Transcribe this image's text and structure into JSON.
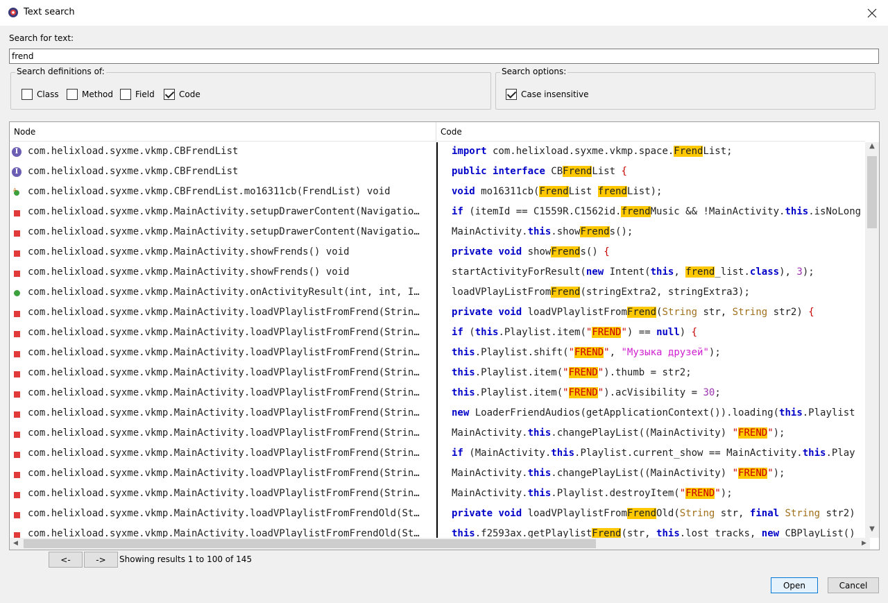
{
  "window": {
    "title": "Text search"
  },
  "search": {
    "label": "Search for text:",
    "value": "frend"
  },
  "definitions": {
    "title": "Search definitions of:",
    "items": [
      {
        "label": "Class",
        "checked": false
      },
      {
        "label": "Method",
        "checked": false
      },
      {
        "label": "Field",
        "checked": false
      },
      {
        "label": "Code",
        "checked": true
      }
    ]
  },
  "options": {
    "title": "Search options:",
    "items": [
      {
        "label": "Case insensitive",
        "checked": true
      }
    ]
  },
  "table": {
    "columns": [
      "Node",
      "Code"
    ],
    "rows": [
      {
        "icon": "interface-icon",
        "node": "com.helixload.syxme.vkmp.CBFrendList",
        "code": [
          [
            "kw",
            "import"
          ],
          [
            "t",
            " com.helixload.syxme.vkmp.space."
          ],
          [
            "hl",
            "Frend"
          ],
          [
            "t",
            "List;"
          ]
        ]
      },
      {
        "icon": "interface-icon",
        "node": "com.helixload.syxme.vkmp.CBFrendList",
        "code": [
          [
            "kw",
            "public"
          ],
          [
            "t",
            " "
          ],
          [
            "kw",
            "interface"
          ],
          [
            "t",
            " CB"
          ],
          [
            "hl",
            "Frend"
          ],
          [
            "t",
            "List "
          ],
          [
            "str",
            "{"
          ]
        ]
      },
      {
        "icon": "abstract-method-icon",
        "node": "com.helixload.syxme.vkmp.CBFrendList.mo16311cb(FrendList) void",
        "code": [
          [
            "kw",
            "void"
          ],
          [
            "t",
            " mo16311cb("
          ],
          [
            "hl",
            "Frend"
          ],
          [
            "t",
            "List "
          ],
          [
            "hl",
            "frend"
          ],
          [
            "t",
            "List);"
          ]
        ]
      },
      {
        "icon": "private-method-icon",
        "node": "com.helixload.syxme.vkmp.MainActivity.setupDrawerContent(Navigatio…",
        "code": [
          [
            "kw",
            "if"
          ],
          [
            "t",
            " (itemId == C1559R.C1562id."
          ],
          [
            "hl",
            "frend"
          ],
          [
            "t",
            "Music && !MainActivity."
          ],
          [
            "kw",
            "this"
          ],
          [
            "t",
            ".isNoLong"
          ]
        ]
      },
      {
        "icon": "private-method-icon",
        "node": "com.helixload.syxme.vkmp.MainActivity.setupDrawerContent(Navigatio…",
        "code": [
          [
            "t",
            "MainActivity."
          ],
          [
            "kw",
            "this"
          ],
          [
            "t",
            ".show"
          ],
          [
            "hl",
            "Frend"
          ],
          [
            "t",
            "s();"
          ]
        ]
      },
      {
        "icon": "private-method-icon",
        "node": "com.helixload.syxme.vkmp.MainActivity.showFrends() void",
        "code": [
          [
            "kw",
            "private"
          ],
          [
            "t",
            " "
          ],
          [
            "kw",
            "void"
          ],
          [
            "t",
            " show"
          ],
          [
            "hl",
            "Frend"
          ],
          [
            "t",
            "s() "
          ],
          [
            "str",
            "{"
          ]
        ]
      },
      {
        "icon": "private-method-icon",
        "node": "com.helixload.syxme.vkmp.MainActivity.showFrends() void",
        "code": [
          [
            "t",
            "startActivityForResult("
          ],
          [
            "kw",
            "new"
          ],
          [
            "t",
            " Intent("
          ],
          [
            "kw",
            "this"
          ],
          [
            "t",
            ", "
          ],
          [
            "hl",
            "frend"
          ],
          [
            "t",
            "_list."
          ],
          [
            "kw",
            "class"
          ],
          [
            "t",
            "), "
          ],
          [
            "num",
            "3"
          ],
          [
            "t",
            ");"
          ]
        ]
      },
      {
        "icon": "public-method-icon",
        "node": "com.helixload.syxme.vkmp.MainActivity.onActivityResult(int, int, I…",
        "code": [
          [
            "t",
            "loadVPlayListFrom"
          ],
          [
            "hl",
            "Frend"
          ],
          [
            "t",
            "(stringExtra2, stringExtra3);"
          ]
        ]
      },
      {
        "icon": "private-method-icon",
        "node": "com.helixload.syxme.vkmp.MainActivity.loadVPlaylistFromFrend(Strin…",
        "code": [
          [
            "kw",
            "private"
          ],
          [
            "t",
            " "
          ],
          [
            "kw",
            "void"
          ],
          [
            "t",
            " loadVPlaylistFrom"
          ],
          [
            "hl",
            "Frend"
          ],
          [
            "t",
            "("
          ],
          [
            "ty",
            "String"
          ],
          [
            "t",
            " str, "
          ],
          [
            "ty",
            "String"
          ],
          [
            "t",
            " str2) "
          ],
          [
            "str",
            "{"
          ]
        ]
      },
      {
        "icon": "private-method-icon",
        "node": "com.helixload.syxme.vkmp.MainActivity.loadVPlaylistFromFrend(Strin…",
        "code": [
          [
            "kw",
            "if"
          ],
          [
            "t",
            " ("
          ],
          [
            "kw",
            "this"
          ],
          [
            "t",
            ".Playlist.item("
          ],
          [
            "str",
            "\""
          ],
          [
            "hlstr",
            "FREND"
          ],
          [
            "str",
            "\""
          ],
          [
            "t",
            ") == "
          ],
          [
            "kw",
            "null"
          ],
          [
            "t",
            ") "
          ],
          [
            "str",
            "{"
          ]
        ]
      },
      {
        "icon": "private-method-icon",
        "node": "com.helixload.syxme.vkmp.MainActivity.loadVPlaylistFromFrend(Strin…",
        "code": [
          [
            "kw",
            "this"
          ],
          [
            "t",
            ".Playlist.shift("
          ],
          [
            "str",
            "\""
          ],
          [
            "hlstr",
            "FREND"
          ],
          [
            "str",
            "\""
          ],
          [
            "t",
            ", "
          ],
          [
            "ru",
            "\"Музыка друзей\""
          ],
          [
            "t",
            ");"
          ]
        ]
      },
      {
        "icon": "private-method-icon",
        "node": "com.helixload.syxme.vkmp.MainActivity.loadVPlaylistFromFrend(Strin…",
        "code": [
          [
            "kw",
            "this"
          ],
          [
            "t",
            ".Playlist.item("
          ],
          [
            "str",
            "\""
          ],
          [
            "hlstr",
            "FREND"
          ],
          [
            "str",
            "\""
          ],
          [
            "t",
            ").thumb = str2;"
          ]
        ]
      },
      {
        "icon": "private-method-icon",
        "node": "com.helixload.syxme.vkmp.MainActivity.loadVPlaylistFromFrend(Strin…",
        "code": [
          [
            "kw",
            "this"
          ],
          [
            "t",
            ".Playlist.item("
          ],
          [
            "str",
            "\""
          ],
          [
            "hlstr",
            "FREND"
          ],
          [
            "str",
            "\""
          ],
          [
            "t",
            ").acVisibility = "
          ],
          [
            "num",
            "30"
          ],
          [
            "t",
            ";"
          ]
        ]
      },
      {
        "icon": "private-method-icon",
        "node": "com.helixload.syxme.vkmp.MainActivity.loadVPlaylistFromFrend(Strin…",
        "code": [
          [
            "kw",
            "new"
          ],
          [
            "t",
            " LoaderFriendAudios(getApplicationContext()).loading("
          ],
          [
            "kw",
            "this"
          ],
          [
            "t",
            ".Playlist"
          ]
        ]
      },
      {
        "icon": "private-method-icon",
        "node": "com.helixload.syxme.vkmp.MainActivity.loadVPlaylistFromFrend(Strin…",
        "code": [
          [
            "t",
            "MainActivity."
          ],
          [
            "kw",
            "this"
          ],
          [
            "t",
            ".changePlayList((MainActivity) "
          ],
          [
            "str",
            "\""
          ],
          [
            "hlstr",
            "FREND"
          ],
          [
            "str",
            "\""
          ],
          [
            "t",
            ");"
          ]
        ]
      },
      {
        "icon": "private-method-icon",
        "node": "com.helixload.syxme.vkmp.MainActivity.loadVPlaylistFromFrend(Strin…",
        "code": [
          [
            "kw",
            "if"
          ],
          [
            "t",
            " (MainActivity."
          ],
          [
            "kw",
            "this"
          ],
          [
            "t",
            ".Playlist.current_show == MainActivity."
          ],
          [
            "kw",
            "this"
          ],
          [
            "t",
            ".Play"
          ]
        ]
      },
      {
        "icon": "private-method-icon",
        "node": "com.helixload.syxme.vkmp.MainActivity.loadVPlaylistFromFrend(Strin…",
        "code": [
          [
            "t",
            "MainActivity."
          ],
          [
            "kw",
            "this"
          ],
          [
            "t",
            ".changePlayList((MainActivity) "
          ],
          [
            "str",
            "\""
          ],
          [
            "hlstr",
            "FREND"
          ],
          [
            "str",
            "\""
          ],
          [
            "t",
            ");"
          ]
        ]
      },
      {
        "icon": "private-method-icon",
        "node": "com.helixload.syxme.vkmp.MainActivity.loadVPlaylistFromFrend(Strin…",
        "code": [
          [
            "t",
            "MainActivity."
          ],
          [
            "kw",
            "this"
          ],
          [
            "t",
            ".Playlist.destroyItem("
          ],
          [
            "str",
            "\""
          ],
          [
            "hlstr",
            "FREND"
          ],
          [
            "str",
            "\""
          ],
          [
            "t",
            ");"
          ]
        ]
      },
      {
        "icon": "private-method-icon",
        "node": "com.helixload.syxme.vkmp.MainActivity.loadVPlaylistFromFrendOld(St…",
        "code": [
          [
            "kw",
            "private"
          ],
          [
            "t",
            " "
          ],
          [
            "kw",
            "void"
          ],
          [
            "t",
            " loadVPlaylistFrom"
          ],
          [
            "hl",
            "Frend"
          ],
          [
            "t",
            "Old("
          ],
          [
            "ty",
            "String"
          ],
          [
            "t",
            " str, "
          ],
          [
            "kw",
            "final"
          ],
          [
            "t",
            " "
          ],
          [
            "ty",
            "String"
          ],
          [
            "t",
            " str2)"
          ]
        ]
      },
      {
        "icon": "private-method-icon",
        "node": "com.helixload.syxme.vkmp.MainActivity.loadVPlaylistFromFrendOld(St…",
        "code": [
          [
            "kw",
            "this"
          ],
          [
            "t",
            ".f2593ax.getPlaylist"
          ],
          [
            "hl",
            "Frend"
          ],
          [
            "t",
            "(str, "
          ],
          [
            "kw",
            "this"
          ],
          [
            "t",
            ".lost_tracks, "
          ],
          [
            "kw",
            "new"
          ],
          [
            "t",
            " CBPlayList()"
          ]
        ]
      }
    ]
  },
  "pager": {
    "prev_label": "<-",
    "next_label": "->",
    "status": "Showing results 1 to 100 of 145"
  },
  "buttons": {
    "open_label": "Open",
    "cancel_label": "Cancel"
  },
  "colors": {
    "highlight": "#ffc800",
    "keyword": "#0000c8",
    "string": "#c80000",
    "accent": "#0078d7"
  }
}
